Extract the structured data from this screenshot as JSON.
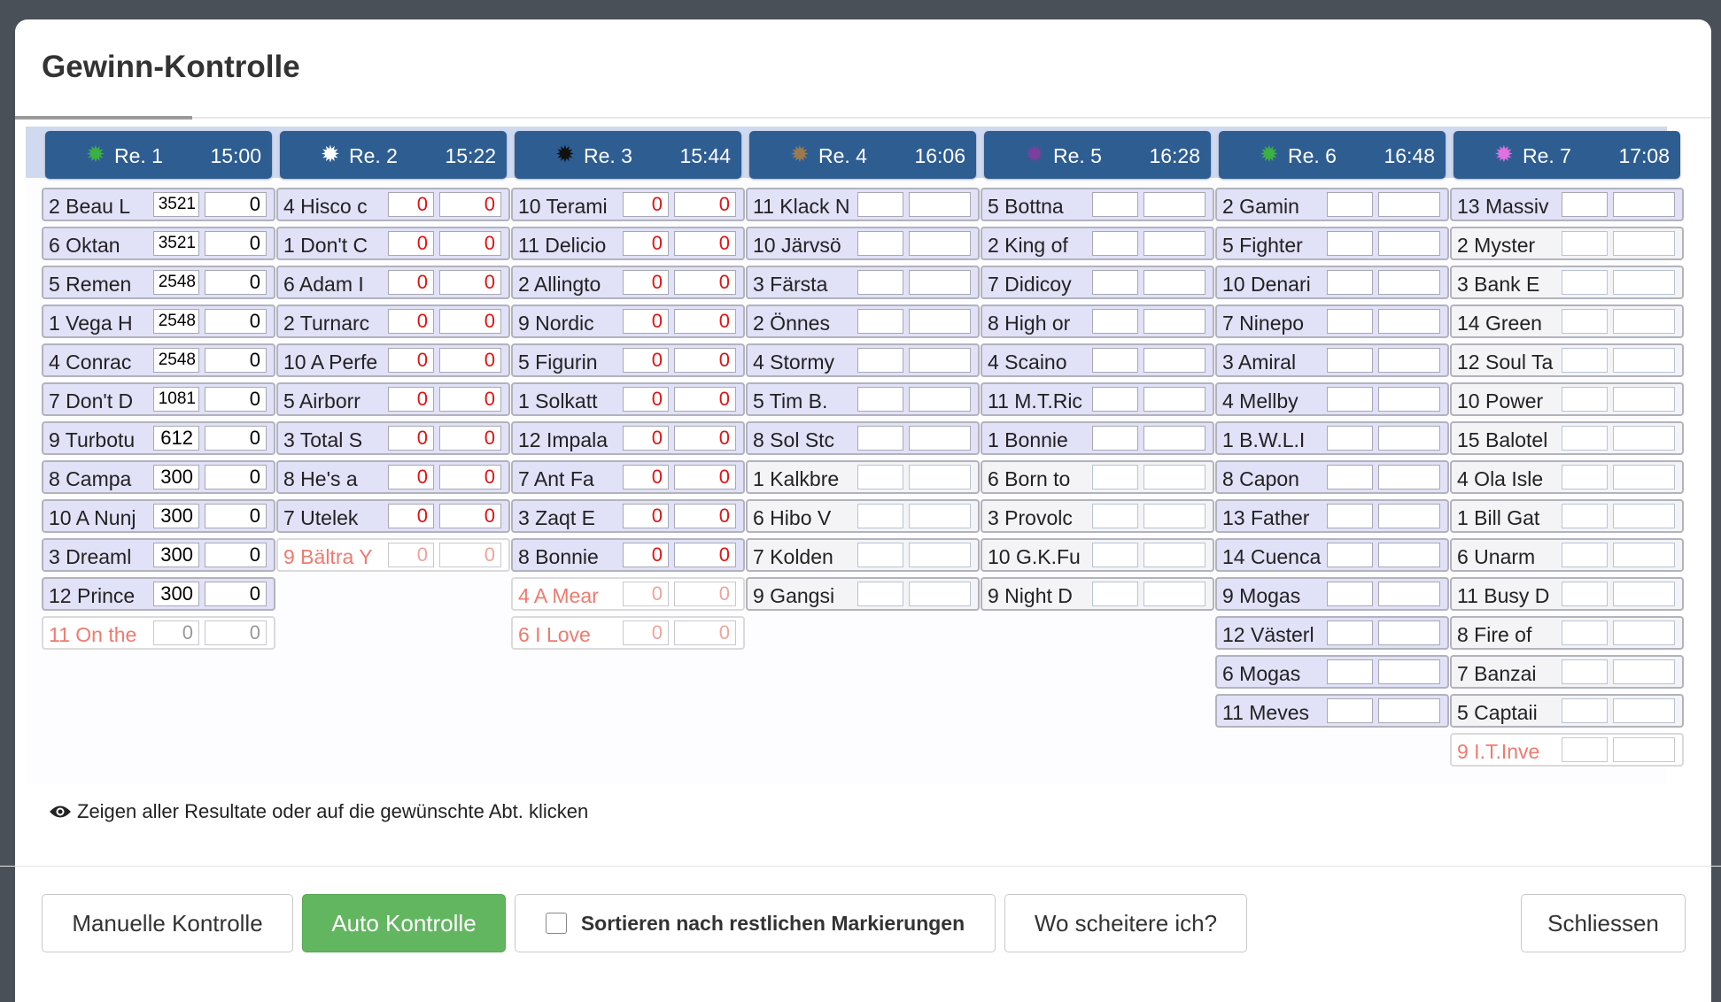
{
  "title": "Gewinn-Kontrolle",
  "info_text": "Zeigen aller Resultate oder auf die gewünschte Abt. klicken",
  "buttons": {
    "manual": "Manuelle Kontrolle",
    "auto": "Auto Kontrolle",
    "sort": "Sortieren nach restlichen Markierungen",
    "fail": "Wo scheitere ich?",
    "close": "Schliessen"
  },
  "races": [
    {
      "label": "Re. 1",
      "time": "15:00",
      "star_color": "#3cb043",
      "rows": [
        {
          "horse": "2 Beau L",
          "v1": "3521",
          "v2": "0"
        },
        {
          "horse": "6 Oktan",
          "v1": "3521",
          "v2": "0"
        },
        {
          "horse": "5 Remen",
          "v1": "2548",
          "v2": "0"
        },
        {
          "horse": "1 Vega H",
          "v1": "2548",
          "v2": "0"
        },
        {
          "horse": "4 Conrac",
          "v1": "2548",
          "v2": "0"
        },
        {
          "horse": "7 Don't D",
          "v1": "1081",
          "v2": "0"
        },
        {
          "horse": "9 Turbotu",
          "v1": "612",
          "v2": "0"
        },
        {
          "horse": "8 Campa",
          "v1": "300",
          "v2": "0"
        },
        {
          "horse": "10 A Nunj",
          "v1": "300",
          "v2": "0"
        },
        {
          "horse": "3 Dreaml",
          "v1": "300",
          "v2": "0"
        },
        {
          "horse": "12 Prince",
          "v1": "300",
          "v2": "0"
        },
        {
          "horse": "11 On the",
          "v1": "0",
          "v2": "0",
          "scratch": true
        }
      ]
    },
    {
      "label": "Re. 2",
      "time": "15:22",
      "star_color": "#ffffff",
      "rows": [
        {
          "horse": "4 Hisco c",
          "v1": "0",
          "v2": "0"
        },
        {
          "horse": "1 Don't C",
          "v1": "0",
          "v2": "0"
        },
        {
          "horse": "6 Adam I",
          "v1": "0",
          "v2": "0"
        },
        {
          "horse": "2 Turnarc",
          "v1": "0",
          "v2": "0"
        },
        {
          "horse": "10 A Perfe",
          "v1": "0",
          "v2": "0"
        },
        {
          "horse": "5 Airborr",
          "v1": "0",
          "v2": "0"
        },
        {
          "horse": "3 Total S",
          "v1": "0",
          "v2": "0"
        },
        {
          "horse": "8 He's a",
          "v1": "0",
          "v2": "0"
        },
        {
          "horse": "7 Utelek",
          "v1": "0",
          "v2": "0"
        },
        {
          "horse": "9 Bältra Y",
          "v1": "0",
          "v2": "0",
          "scratch": true
        }
      ]
    },
    {
      "label": "Re. 3",
      "time": "15:44",
      "star_color": "#111111",
      "rows": [
        {
          "horse": "10 Terami",
          "v1": "0",
          "v2": "0"
        },
        {
          "horse": "11 Delicio",
          "v1": "0",
          "v2": "0"
        },
        {
          "horse": "2 Allingto",
          "v1": "0",
          "v2": "0"
        },
        {
          "horse": "9 Nordic",
          "v1": "0",
          "v2": "0"
        },
        {
          "horse": "5 Figurin",
          "v1": "0",
          "v2": "0"
        },
        {
          "horse": "1 Solkatt",
          "v1": "0",
          "v2": "0"
        },
        {
          "horse": "12 Impala",
          "v1": "0",
          "v2": "0"
        },
        {
          "horse": "7 Ant Fa",
          "v1": "0",
          "v2": "0"
        },
        {
          "horse": "3 Zaqt E",
          "v1": "0",
          "v2": "0"
        },
        {
          "horse": "8 Bonnie",
          "v1": "0",
          "v2": "0"
        },
        {
          "horse": "4 A Mear",
          "v1": "0",
          "v2": "0",
          "scratch": true
        },
        {
          "horse": "6 I Love",
          "v1": "0",
          "v2": "0",
          "scratch": true
        }
      ]
    },
    {
      "label": "Re. 4",
      "time": "16:06",
      "star_color": "#9a7b4f",
      "rows": [
        {
          "horse": "11 Klack N",
          "v1": "",
          "v2": ""
        },
        {
          "horse": "10 Järvsö",
          "v1": "",
          "v2": ""
        },
        {
          "horse": "3 Färsta",
          "v1": "",
          "v2": ""
        },
        {
          "horse": "2 Önnes",
          "v1": "",
          "v2": ""
        },
        {
          "horse": "4 Stormy",
          "v1": "",
          "v2": ""
        },
        {
          "horse": "5 Tim B.",
          "v1": "",
          "v2": ""
        },
        {
          "horse": "8 Sol Stc",
          "v1": "",
          "v2": ""
        },
        {
          "horse": "1 Kalkbre",
          "v1": "",
          "v2": "",
          "white": true
        },
        {
          "horse": "6 Hibo V",
          "v1": "",
          "v2": "",
          "white": true
        },
        {
          "horse": "7 Kolden",
          "v1": "",
          "v2": "",
          "white": true
        },
        {
          "horse": "9 Gangsi",
          "v1": "",
          "v2": "",
          "white": true
        }
      ]
    },
    {
      "label": "Re. 5",
      "time": "16:28",
      "star_color": "#7b3f9e",
      "rows": [
        {
          "horse": "5 Bottna",
          "v1": "",
          "v2": ""
        },
        {
          "horse": "2 King of",
          "v1": "",
          "v2": ""
        },
        {
          "horse": "7 Didicoy",
          "v1": "",
          "v2": ""
        },
        {
          "horse": "8 High or",
          "v1": "",
          "v2": ""
        },
        {
          "horse": "4 Scaino",
          "v1": "",
          "v2": ""
        },
        {
          "horse": "11 M.T.Ric",
          "v1": "",
          "v2": ""
        },
        {
          "horse": "1 Bonnie",
          "v1": "",
          "v2": ""
        },
        {
          "horse": "6 Born to",
          "v1": "",
          "v2": "",
          "white": true
        },
        {
          "horse": "3 Provolc",
          "v1": "",
          "v2": "",
          "white": true
        },
        {
          "horse": "10 G.K.Fu",
          "v1": "",
          "v2": "",
          "white": true
        },
        {
          "horse": "9 Night D",
          "v1": "",
          "v2": "",
          "white": true
        }
      ]
    },
    {
      "label": "Re. 6",
      "time": "16:48",
      "star_color": "#3cb043",
      "rows": [
        {
          "horse": "2 Gamin",
          "v1": "",
          "v2": ""
        },
        {
          "horse": "5 Fighter",
          "v1": "",
          "v2": ""
        },
        {
          "horse": "10 Denari",
          "v1": "",
          "v2": ""
        },
        {
          "horse": "7 Ninepo",
          "v1": "",
          "v2": ""
        },
        {
          "horse": "3 Amiral",
          "v1": "",
          "v2": ""
        },
        {
          "horse": "4 Mellby",
          "v1": "",
          "v2": ""
        },
        {
          "horse": "1 B.W.L.I",
          "v1": "",
          "v2": ""
        },
        {
          "horse": "8 Capon",
          "v1": "",
          "v2": ""
        },
        {
          "horse": "13 Father",
          "v1": "",
          "v2": ""
        },
        {
          "horse": "14 Cuenca",
          "v1": "",
          "v2": ""
        },
        {
          "horse": "9 Mogas",
          "v1": "",
          "v2": ""
        },
        {
          "horse": "12 Västerl",
          "v1": "",
          "v2": ""
        },
        {
          "horse": "6 Mogas",
          "v1": "",
          "v2": ""
        },
        {
          "horse": "11 Meves",
          "v1": "",
          "v2": ""
        }
      ]
    },
    {
      "label": "Re. 7",
      "time": "17:08",
      "star_color": "#e070e0",
      "rows": [
        {
          "horse": "13 Massiv",
          "v1": "",
          "v2": ""
        },
        {
          "horse": "2 Myster",
          "v1": "",
          "v2": "",
          "white": true
        },
        {
          "horse": "3 Bank E",
          "v1": "",
          "v2": "",
          "white": true
        },
        {
          "horse": "14 Green",
          "v1": "",
          "v2": "",
          "white": true
        },
        {
          "horse": "12 Soul Ta",
          "v1": "",
          "v2": "",
          "white": true
        },
        {
          "horse": "10 Power",
          "v1": "",
          "v2": "",
          "white": true
        },
        {
          "horse": "15 Balotel",
          "v1": "",
          "v2": "",
          "white": true
        },
        {
          "horse": "4 Ola Isle",
          "v1": "",
          "v2": "",
          "white": true
        },
        {
          "horse": "1 Bill Gat",
          "v1": "",
          "v2": "",
          "white": true
        },
        {
          "horse": "6 Unarm",
          "v1": "",
          "v2": "",
          "white": true
        },
        {
          "horse": "11 Busy D",
          "v1": "",
          "v2": "",
          "white": true
        },
        {
          "horse": "8 Fire of",
          "v1": "",
          "v2": "",
          "white": true
        },
        {
          "horse": "7 Banzai",
          "v1": "",
          "v2": "",
          "white": true
        },
        {
          "horse": "5 Captaii",
          "v1": "",
          "v2": "",
          "white": true
        },
        {
          "horse": "9 I.T.Inve",
          "v1": "",
          "v2": "",
          "scratch": true
        }
      ]
    }
  ]
}
